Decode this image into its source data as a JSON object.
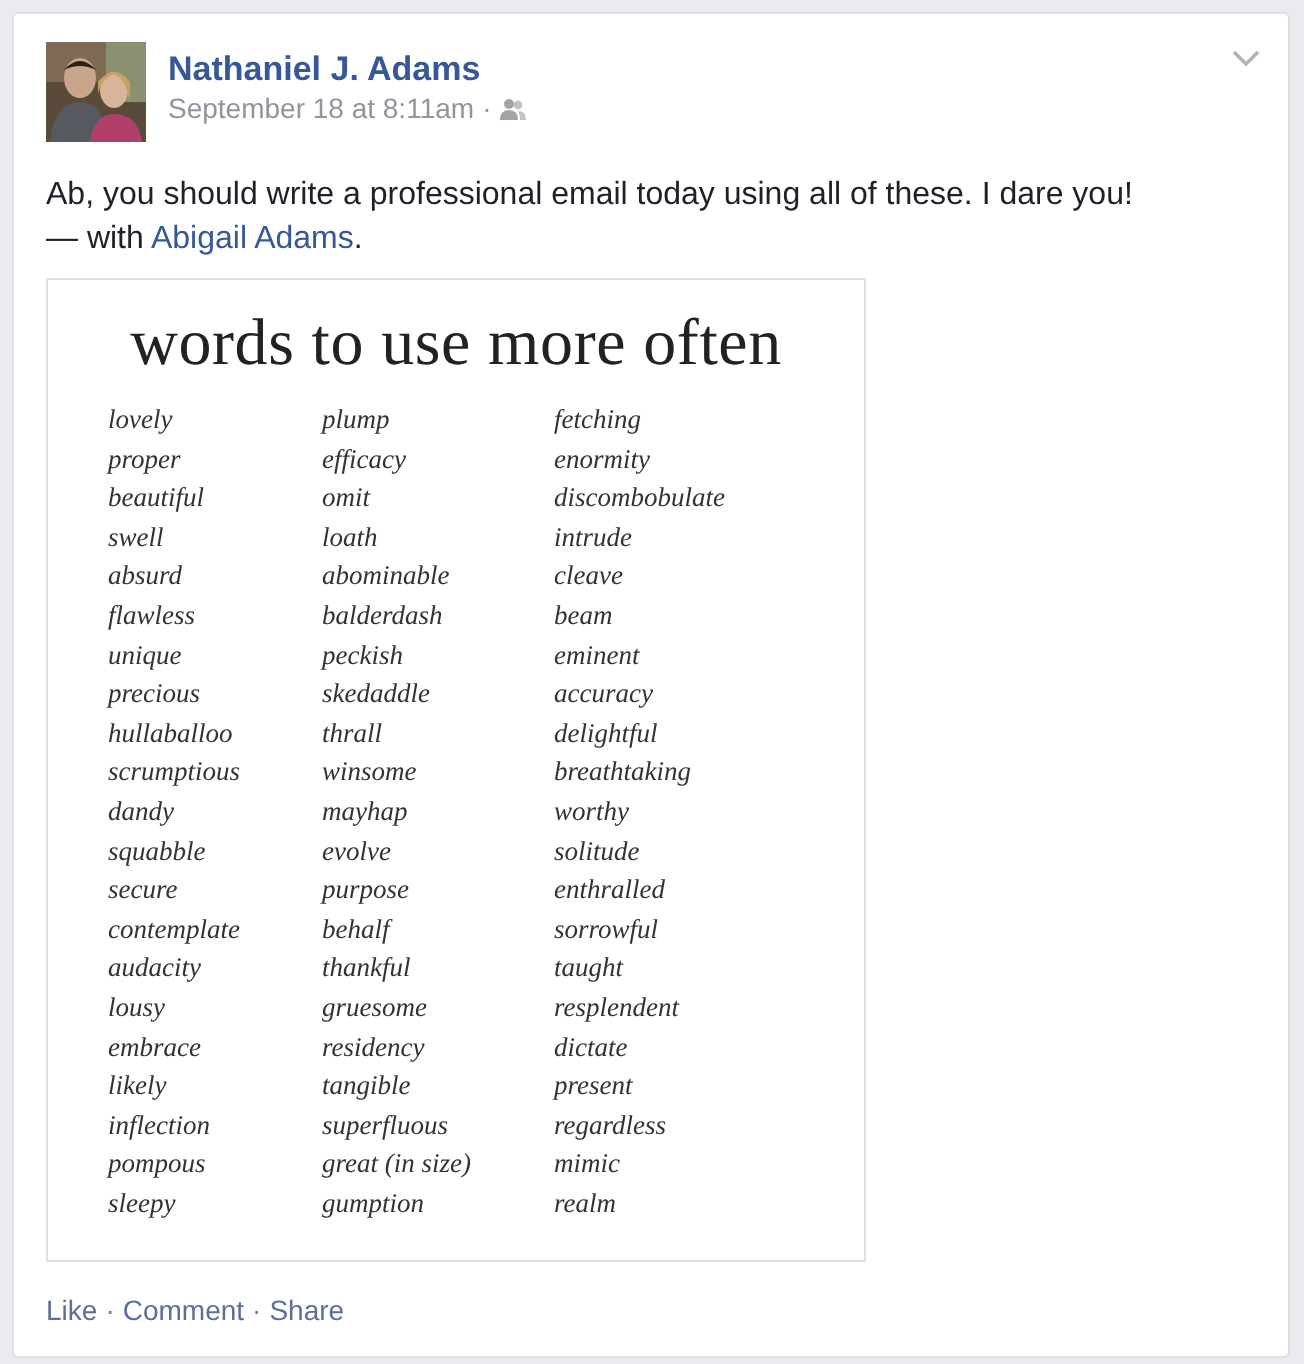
{
  "post": {
    "author": "Nathaniel J. Adams",
    "timestamp": "September 18 at 8:11am",
    "meta_separator": "·",
    "message": "Ab, you should write a professional email today using all of these. I dare you!",
    "tag_prefix": "— with",
    "tagged_name": "Abigail Adams",
    "tag_suffix": "."
  },
  "image": {
    "title": "words to use more often",
    "columns": [
      [
        "lovely",
        "proper",
        "beautiful",
        "swell",
        "absurd",
        "flawless",
        "unique",
        "precious",
        "hullaballoo",
        "scrumptious",
        "dandy",
        "squabble",
        "secure",
        "contemplate",
        "audacity",
        "lousy",
        "embrace",
        "likely",
        "inflection",
        "pompous",
        "sleepy"
      ],
      [
        "plump",
        "efficacy",
        "omit",
        "loath",
        "abominable",
        "balderdash",
        "peckish",
        "skedaddle",
        "thrall",
        "winsome",
        "mayhap",
        "evolve",
        "purpose",
        "behalf",
        "thankful",
        "gruesome",
        "residency",
        "tangible",
        "superfluous",
        "great (in size)",
        "gumption"
      ],
      [
        "fetching",
        "enormity",
        "discombobulate",
        "intrude",
        "cleave",
        "beam",
        "eminent",
        "accuracy",
        "delightful",
        "breathtaking",
        "worthy",
        "solitude",
        "enthralled",
        "sorrowful",
        "taught",
        "resplendent",
        "dictate",
        "present",
        "regardless",
        "mimic",
        "realm"
      ]
    ]
  },
  "actions": [
    {
      "label": "Like"
    },
    {
      "label": "Comment"
    },
    {
      "label": "Share"
    }
  ],
  "action_separator": "·"
}
